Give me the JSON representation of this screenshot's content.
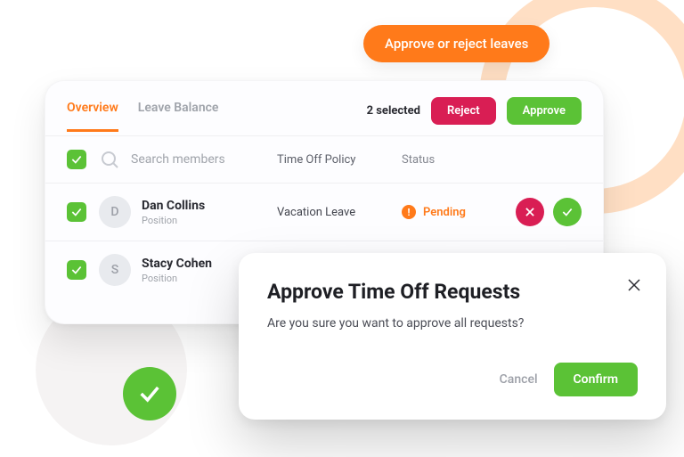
{
  "tooltip": "Approve or reject leaves",
  "tabs": {
    "overview": "Overview",
    "leave_balance": "Leave Balance"
  },
  "header": {
    "selected_text": "2 selected",
    "reject_label": "Reject",
    "approve_label": "Approve"
  },
  "columns": {
    "search_placeholder": "Search members",
    "policy": "Time Off Policy",
    "status": "Status"
  },
  "rows": [
    {
      "initial": "D",
      "name": "Dan Collins",
      "subtitle": "Position",
      "policy": "Vacation Leave",
      "status_label": "Pending",
      "status_glyph": "!"
    },
    {
      "initial": "S",
      "name": "Stacy Cohen",
      "subtitle": "Position"
    }
  ],
  "modal": {
    "title": "Approve Time Off Requests",
    "body": "Are you sure you want to approve all requests?",
    "cancel_label": "Cancel",
    "confirm_label": "Confirm"
  },
  "colors": {
    "primary": "#FF7A1A",
    "success": "#5BC236",
    "danger": "#D91E54"
  }
}
